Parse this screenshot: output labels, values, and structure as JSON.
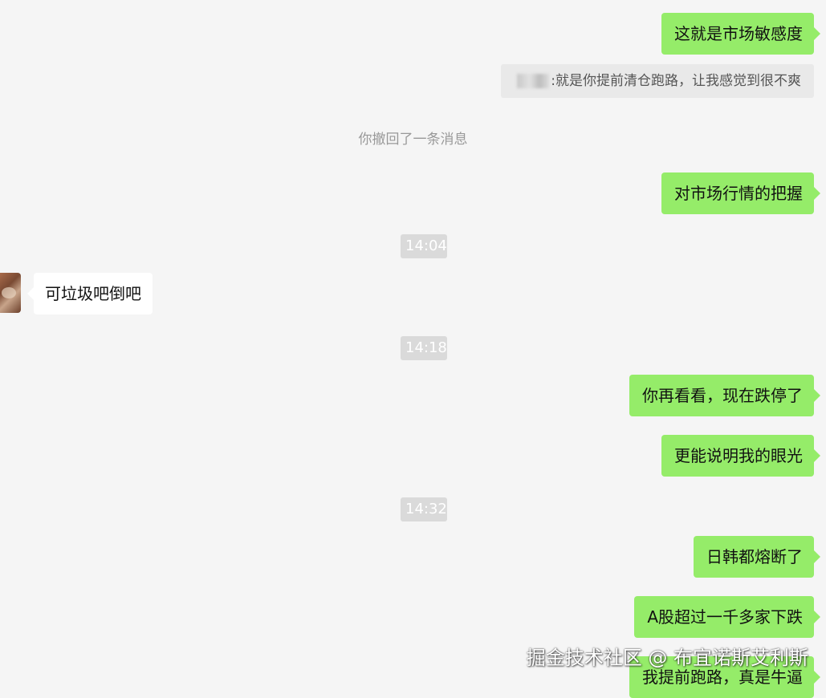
{
  "messages": [
    {
      "direction": "out",
      "text": "这就是市场敏感度"
    },
    {
      "direction": "out",
      "text": "对市场行情的把握"
    },
    {
      "direction": "in",
      "text": "可垃圾吧倒吧"
    },
    {
      "direction": "out",
      "text": "你再看看，现在跌停了"
    },
    {
      "direction": "out",
      "text": "更能说明我的眼光"
    },
    {
      "direction": "out",
      "text": "日韩都熔断了"
    },
    {
      "direction": "out",
      "text": "A股超过一千多家下跌"
    },
    {
      "direction": "out",
      "text": "我提前跑路，真是牛逼"
    }
  ],
  "quote": {
    "separator": ":",
    "text": "就是你提前清仓跑路，让我感觉到很不爽"
  },
  "system_notice": "你撤回了一条消息",
  "timestamps": [
    "14:04",
    "14:18",
    "14:32"
  ],
  "watermark": "掘金技术社区 @ 布宜诺斯艾利斯",
  "colors": {
    "background": "#f5f5f5",
    "outgoing_bubble": "#95ec69",
    "incoming_bubble": "#ffffff",
    "timestamp_bg": "#dadada",
    "system_text": "#999999"
  },
  "icons": {
    "avatar": "contact-avatar-image",
    "blurred_name": "redacted-name-blur"
  }
}
